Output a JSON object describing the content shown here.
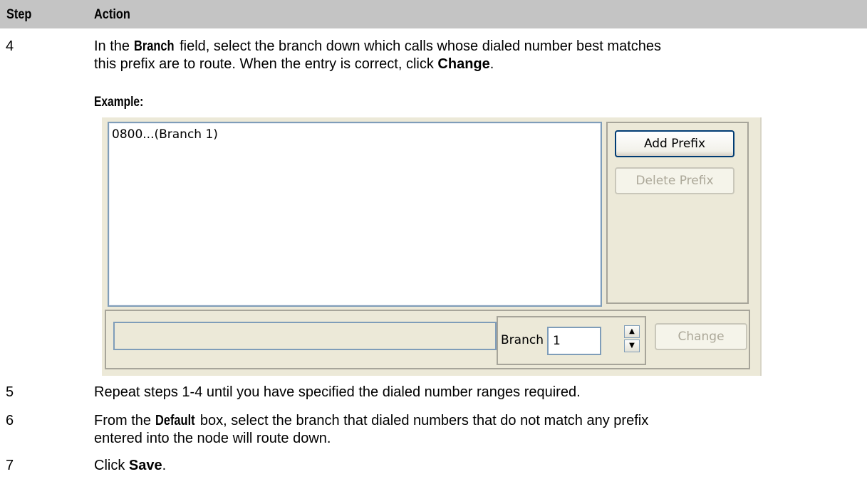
{
  "header": {
    "step_col": "Step",
    "action_col": "Action"
  },
  "rows": [
    {
      "step": "4",
      "line1_pre": "In the ",
      "line1_bold": "Branch",
      "line1_post": " field, select the branch down which calls whose dialed number best matches",
      "line2_pre": "this prefix are to route.   When the entry is correct, click ",
      "line2_bold": "Change",
      "line2_post": "."
    },
    {
      "step": "5",
      "text": "Repeat steps 1-4 until you have specified the dialed number ranges required."
    },
    {
      "step": "6",
      "line1_pre": "From the ",
      "line1_bold": "Default",
      "line1_post": " box, select the branch that dialed numbers that do not match any prefix",
      "line2": "entered into the node will route down."
    },
    {
      "step": "7",
      "pre": "Click ",
      "bold": "Save",
      "post": "."
    }
  ],
  "example_label": "Example:",
  "dialog": {
    "list_items": [
      "0800...(Branch 1)"
    ],
    "add_prefix_label": "Add Prefix",
    "delete_prefix_label": "Delete Prefix",
    "prefix_field_value": "",
    "branch_label": "Branch",
    "branch_value": "1",
    "spin_up_icon": "arrow-up-icon",
    "spin_down_icon": "arrow-down-icon",
    "change_label": "Change"
  }
}
